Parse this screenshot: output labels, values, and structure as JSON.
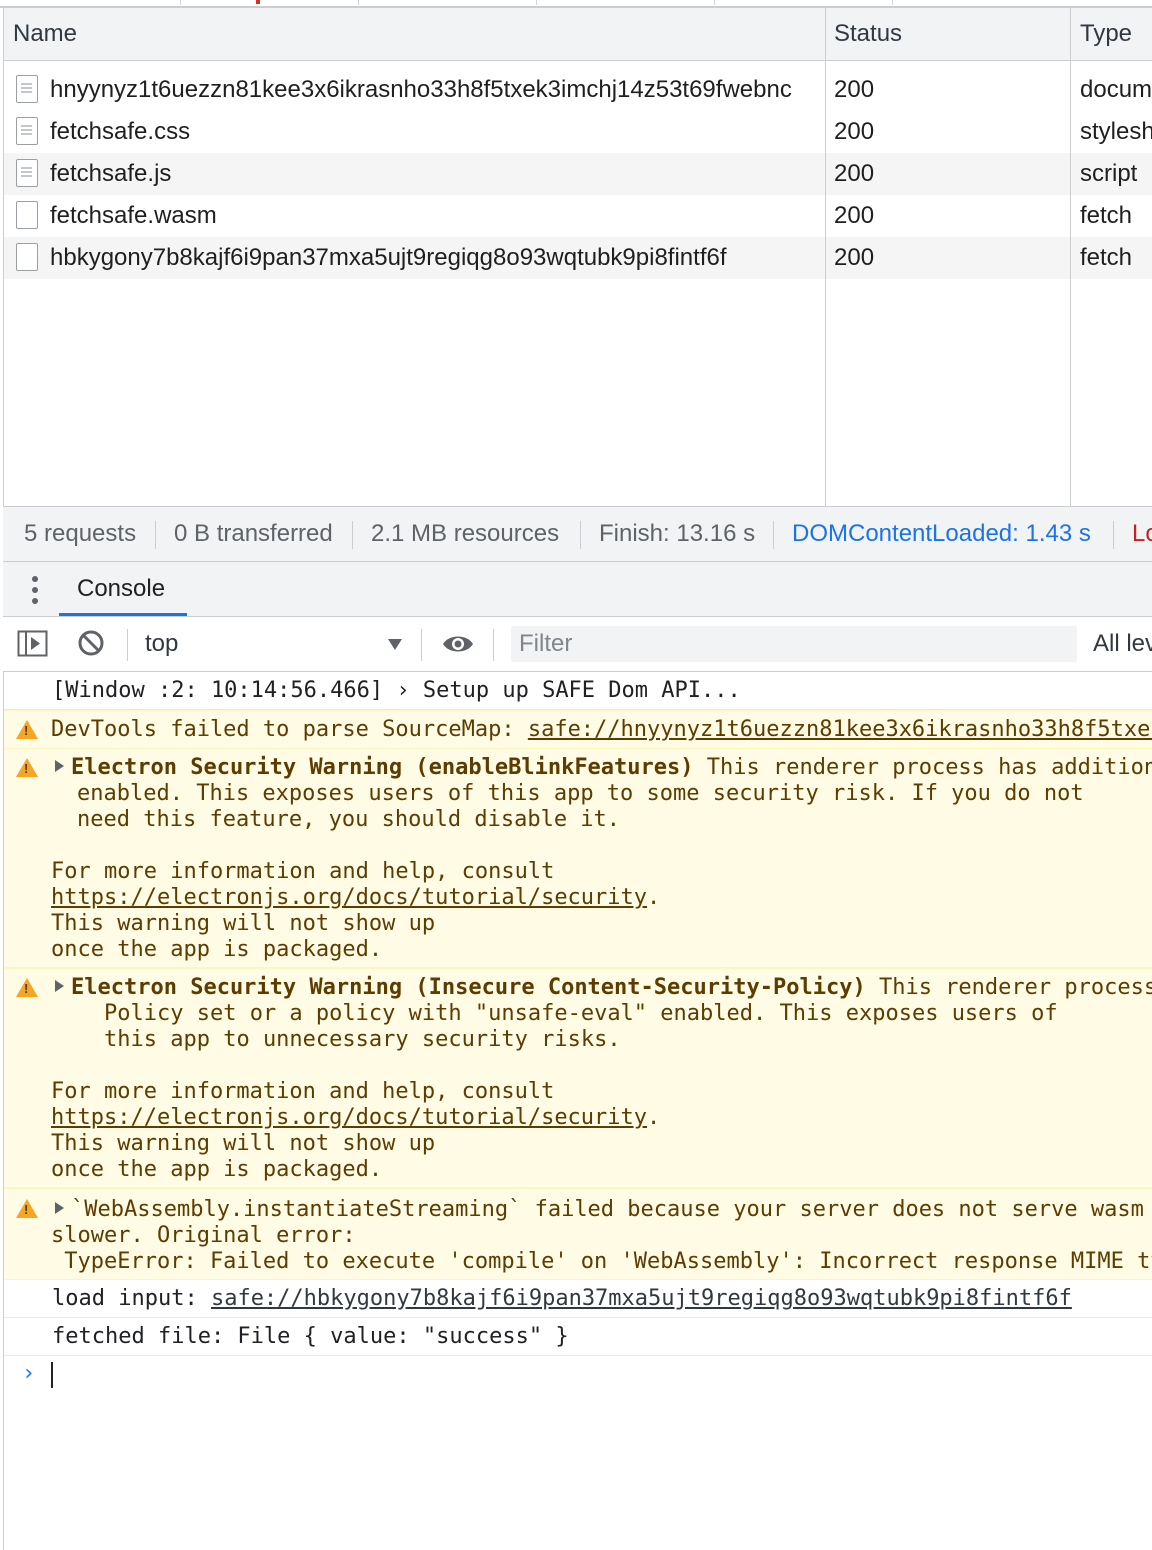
{
  "network": {
    "columns": [
      "Name",
      "Status",
      "Type"
    ],
    "rows": [
      {
        "name": "hnyynyz1t6uezzn81kee3x6ikrasnho33h8f5txek3imchj14z53t69fwebnc",
        "status": "200",
        "type": "docum",
        "icon": "document-file-icon"
      },
      {
        "name": "fetchsafe.css",
        "status": "200",
        "type": "stylesh",
        "icon": "document-file-icon"
      },
      {
        "name": "fetchsafe.js",
        "status": "200",
        "type": "script",
        "icon": "document-file-icon"
      },
      {
        "name": "fetchsafe.wasm",
        "status": "200",
        "type": "fetch",
        "icon": "blank-file-icon"
      },
      {
        "name": "hbkygony7b8kajf6i9pan37mxa5ujt9regiqg8o93wqtubk9pi8fintf6f",
        "status": "200",
        "type": "fetch",
        "icon": "blank-file-icon"
      }
    ]
  },
  "summary": {
    "requests": "5 requests",
    "transferred": "0 B transferred",
    "resources": "2.1 MB resources",
    "finish": "Finish: 13.16 s",
    "dcl": "DOMContentLoaded: 1.43 s",
    "load": "Lo",
    "colors": {
      "dcl": "#1a73e8",
      "load": "#c5221f"
    }
  },
  "drawer": {
    "console_tab": "Console"
  },
  "toolbar": {
    "context": "top",
    "filter_placeholder": "Filter",
    "levels": "All lev"
  },
  "console": {
    "m1": "[Window :2: 10:14:56.466] › Setup up SAFE Dom API...",
    "m2_text": "DevTools failed to parse SourceMap: ",
    "m2_link": "safe://hnyynyz1t6uezzn81kee3x6ikrasnho33h8f5txek",
    "m3_title": "Electron Security Warning (enableBlinkFeatures)",
    "m3_rest": " This renderer process has addition",
    "m3_l2": "enabled. This exposes users of this app to some security risk. If you do not",
    "m3_l3": "need this feature, you should disable it.",
    "more_info": "For more information and help, consult",
    "security_link": "https://electronjs.org/docs/tutorial/security",
    "period": ".",
    "not_show": "This warning will not show up",
    "packaged": "once the app is packaged.",
    "m4_title": "Electron Security Warning (Insecure Content-Security-Policy)",
    "m4_rest": " This renderer process",
    "m4_l2": "Policy set or a policy with \"unsafe-eval\" enabled. This exposes users of",
    "m4_l3": "this app to unnecessary security risks.",
    "m5_l1": "`WebAssembly.instantiateStreaming` failed because your server does not serve wasm",
    "m5_l2": "slower. Original error:",
    "m5_l3": " TypeError: Failed to execute 'compile' on 'WebAssembly': Incorrect response MIME ty",
    "m6_text": "load input: ",
    "m6_link": "safe://hbkygony7b8kajf6i9pan37mxa5ujt9regiqg8o93wqtubk9pi8fintf6f",
    "m7": "fetched file: File { value: \"success\" }",
    "prompt": "›"
  }
}
